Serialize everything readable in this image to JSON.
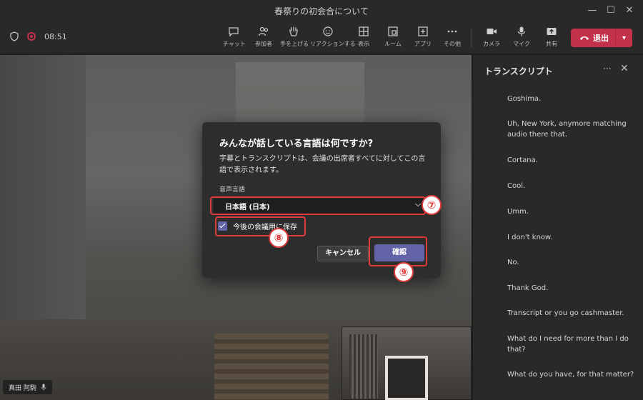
{
  "window": {
    "title": "春祭りの初会合について",
    "minimize": "—",
    "maximize": "☐",
    "close": "✕"
  },
  "toolbar": {
    "timer": "08:51",
    "buttons": [
      {
        "label": "チャット",
        "icon": "chat-icon"
      },
      {
        "label": "参加者",
        "icon": "people-icon"
      },
      {
        "label": "手を上げる",
        "icon": "raise-hand-icon"
      },
      {
        "label": "リアクションする",
        "icon": "reaction-icon"
      },
      {
        "label": "表示",
        "icon": "view-icon"
      },
      {
        "label": "ルーム",
        "icon": "room-icon"
      },
      {
        "label": "アプリ",
        "icon": "apps-icon"
      },
      {
        "label": "その他",
        "icon": "more-icon"
      },
      {
        "label": "カメラ",
        "icon": "camera-icon"
      },
      {
        "label": "マイク",
        "icon": "mic-icon"
      },
      {
        "label": "共有",
        "icon": "share-icon"
      }
    ],
    "leave_label": "退出"
  },
  "video": {
    "participant_name": "真田 阿駒"
  },
  "transcript": {
    "title": "トランスクリプト",
    "more": "···",
    "close": "✕",
    "lines": [
      "Goshima.",
      "Uh, New York, anymore matching audio there that.",
      "Cortana.",
      "Cool.",
      "Umm.",
      "I don't know.",
      "No.",
      "Thank God.",
      "Transcript or you go cashmaster.",
      "What do I need for more than I do that?",
      "What do you have, for that matter?"
    ]
  },
  "dialog": {
    "title": "みんなが話している言語は何ですか?",
    "description": "字幕とトランスクリプトは、会議の出席者すべてに対してこの言語で表示されます。",
    "language_label": "音声言語",
    "language_value": "日本語 (日本)",
    "save_checkbox_label": "今後の会議用に保存",
    "save_checked": true,
    "cancel_label": "キャンセル",
    "confirm_label": "確認"
  },
  "annotations": {
    "badge_7": "⑦",
    "badge_8": "⑧",
    "badge_9": "⑨",
    "color": "#e03b3b"
  }
}
